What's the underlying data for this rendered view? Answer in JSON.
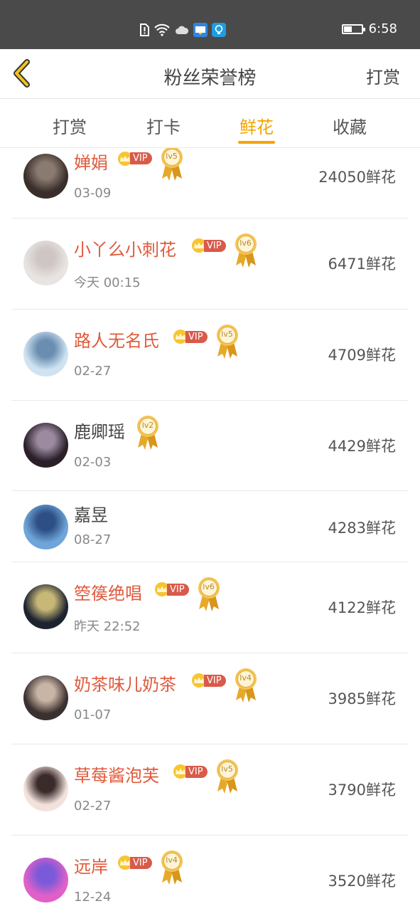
{
  "status_bar": {
    "time": "6:58"
  },
  "header": {
    "title": "粉丝荣誉榜",
    "right_action": "打赏"
  },
  "tabs": [
    {
      "label": "打赏",
      "active": false
    },
    {
      "label": "打卡",
      "active": false
    },
    {
      "label": "鲜花",
      "active": true
    },
    {
      "label": "收藏",
      "active": false
    }
  ],
  "colors": {
    "accent": "#f5a300",
    "vip_name": "#e05a3c",
    "status_bar": "#4a4a4a"
  },
  "fans": [
    {
      "name": "婵娟",
      "vip": true,
      "level": "lv5",
      "date": "03-09",
      "count": "24050鲜花"
    },
    {
      "name": "小丫么小刺花",
      "vip": true,
      "level": "lv6",
      "date": "今天 00:15",
      "count": "6471鲜花"
    },
    {
      "name": "路人无名氏",
      "vip": true,
      "level": "lv5",
      "date": "02-27",
      "count": "4709鲜花"
    },
    {
      "name": "鹿卿瑶",
      "vip": false,
      "level": "lv2",
      "date": "02-03",
      "count": "4429鲜花"
    },
    {
      "name": "嘉昱",
      "vip": false,
      "level": "",
      "date": "08-27",
      "count": "4283鲜花"
    },
    {
      "name": "箜篌绝唱",
      "vip": true,
      "level": "lv6",
      "date": "昨天 22:52",
      "count": "4122鲜花"
    },
    {
      "name": "奶茶味儿奶茶",
      "vip": true,
      "level": "lv4",
      "date": "01-07",
      "count": "3985鲜花"
    },
    {
      "name": "草莓酱泡芙",
      "vip": true,
      "level": "lv5",
      "date": "02-27",
      "count": "3790鲜花"
    },
    {
      "name": "远岸",
      "vip": true,
      "level": "lv4",
      "date": "12-24",
      "count": "3520鲜花"
    }
  ],
  "vip_label": "VIP"
}
